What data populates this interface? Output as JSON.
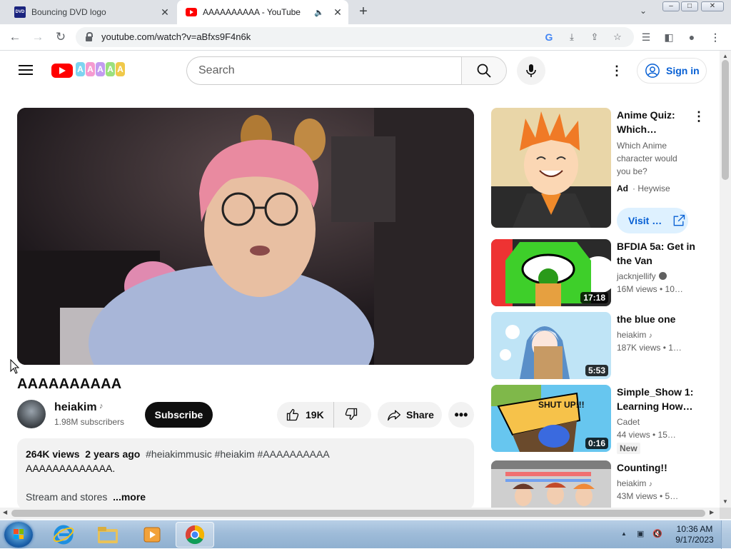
{
  "browser": {
    "tabs": [
      {
        "title": "Bouncing DVD logo",
        "favicon": "dvd-favicon",
        "active": false
      },
      {
        "title": "AAAAAAAAAA - YouTube",
        "favicon": "youtube-favicon",
        "active": true
      }
    ],
    "favicon_dvd_text": "DVD",
    "url": "youtube.com/watch?v=aBfxs9F4n6k",
    "window_controls": [
      "minimize",
      "maximize",
      "close"
    ]
  },
  "header": {
    "search_placeholder": "Search",
    "sign_in_label": "Sign in",
    "doodle_letters": [
      "A",
      "A",
      "A",
      "A",
      "A"
    ],
    "doodle_colors": [
      "#7ed4f0",
      "#f59ad0",
      "#c39bf0",
      "#9be07e",
      "#f0c94a"
    ]
  },
  "video": {
    "title": "AAAAAAAAAA",
    "channel": "heiakim",
    "channel_badge": "music-note-icon",
    "subscribers": "1.98M subscribers",
    "subscribe_label": "Subscribe",
    "likes": "19K",
    "share_label": "Share",
    "description": {
      "views": "264K views",
      "date": "2 years ago",
      "hashtags": "#heiakimmusic #heiakim #AAAAAAAAAA",
      "line1": "AAAAAAAAAAAAA.",
      "line2": "Stream and stores",
      "more_label": "...more"
    }
  },
  "sidebar": {
    "ad": {
      "title": "Anime Quiz: Which…",
      "description": "Which Anime character would you be?",
      "badge": "Ad",
      "advertiser": "Heywise",
      "button_label": "Visit …"
    },
    "recommendations": [
      {
        "title": "BFDIA 5a: Get in the Van",
        "channel": "jacknjellify",
        "verified": true,
        "meta": "16M views • 10…",
        "duration": "17:18"
      },
      {
        "title": "the blue one",
        "channel": "heiakim",
        "music": true,
        "meta": "187K views • 1…",
        "duration": "5:53"
      },
      {
        "title": "Simple_Show 1: Learning How…",
        "channel": "Cadet",
        "meta": "44 views • 15…",
        "duration": "0:16",
        "badge": "New",
        "thumb_text": "SHUT UP!!!"
      },
      {
        "title": "Counting!!",
        "channel": "heiakim",
        "music": true,
        "meta": "43M views • 5…"
      }
    ]
  },
  "taskbar": {
    "pinned": [
      "internet-explorer-icon",
      "file-explorer-icon",
      "media-player-icon",
      "chrome-icon"
    ],
    "active": "chrome-icon",
    "clock_time": "10:36 AM",
    "clock_date": "9/17/2023"
  },
  "colors": {
    "yt_red": "#ff0000",
    "link_blue": "#065fd4",
    "subscribe_bg": "#0f0f0f",
    "pill_bg": "#f2f2f2"
  }
}
